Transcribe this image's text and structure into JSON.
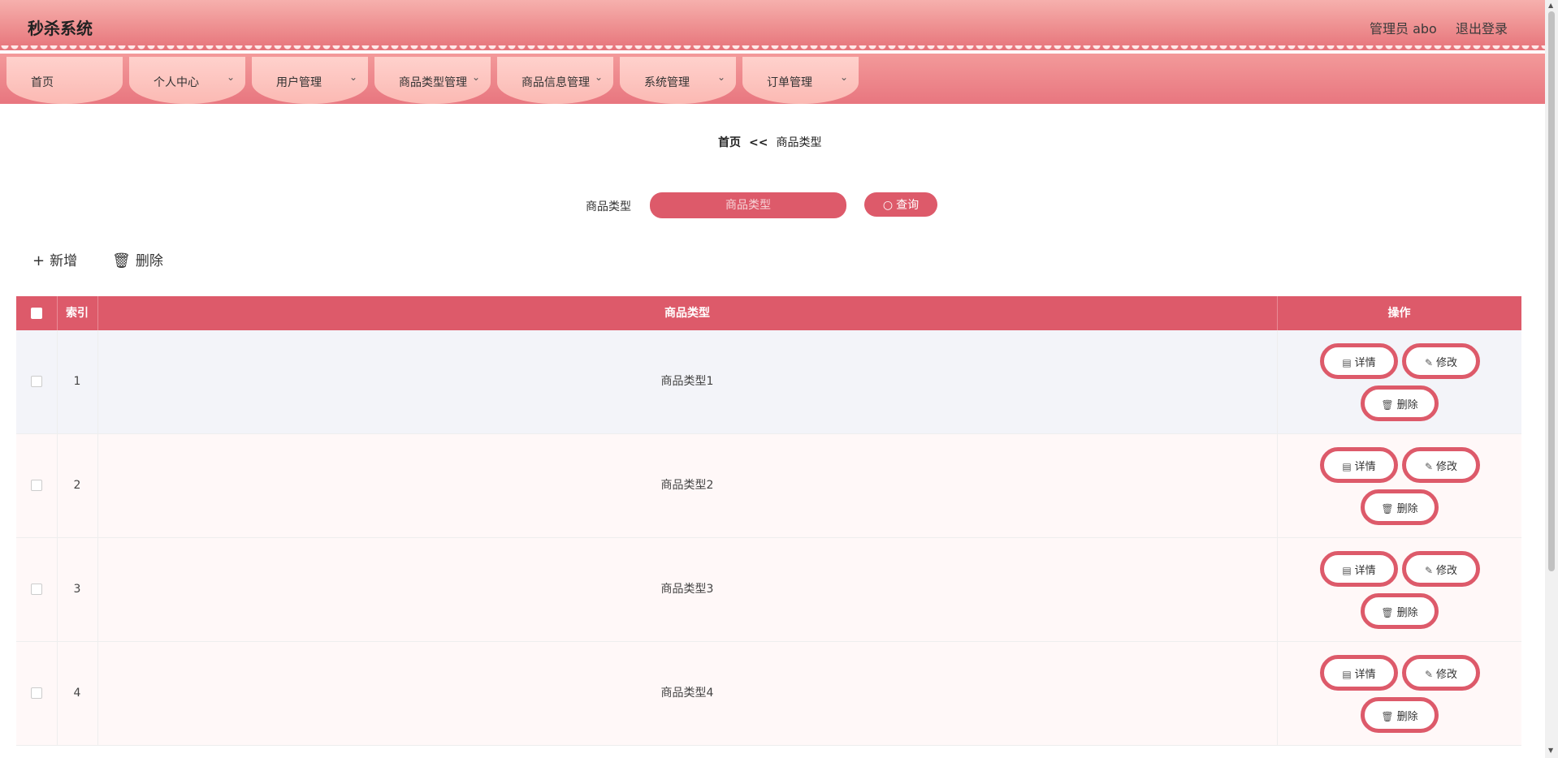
{
  "header": {
    "title": "秒杀系统",
    "admin_label": "管理员 abo",
    "logout_label": "退出登录"
  },
  "nav": {
    "items": [
      {
        "label": "首页",
        "has_dropdown": false
      },
      {
        "label": "个人中心",
        "has_dropdown": true
      },
      {
        "label": "用户管理",
        "has_dropdown": true
      },
      {
        "label": "商品类型管理",
        "has_dropdown": true
      },
      {
        "label": "商品信息管理",
        "has_dropdown": true
      },
      {
        "label": "系统管理",
        "has_dropdown": true
      },
      {
        "label": "订单管理",
        "has_dropdown": true
      }
    ]
  },
  "breadcrumb": {
    "home": "首页",
    "separator": "<<",
    "current": "商品类型"
  },
  "search": {
    "label": "商品类型",
    "placeholder": "商品类型",
    "value": "",
    "button_label": "查询"
  },
  "toolbar": {
    "add_label": "新增",
    "delete_label": "删除"
  },
  "table": {
    "columns": [
      "",
      "索引",
      "商品类型",
      "操作"
    ],
    "rows": [
      {
        "index": "1",
        "type": "商品类型1"
      },
      {
        "index": "2",
        "type": "商品类型2"
      },
      {
        "index": "3",
        "type": "商品类型3"
      },
      {
        "index": "4",
        "type": "商品类型4"
      }
    ],
    "actions": {
      "detail": "详情",
      "edit": "修改",
      "delete": "删除"
    }
  },
  "colors": {
    "accent": "#dd5a6a",
    "header_top": "#f6b0ad",
    "nav_tab": "#fbb9b3",
    "row_odd": "#f3f4f9",
    "row_even": "#fff8f8"
  }
}
